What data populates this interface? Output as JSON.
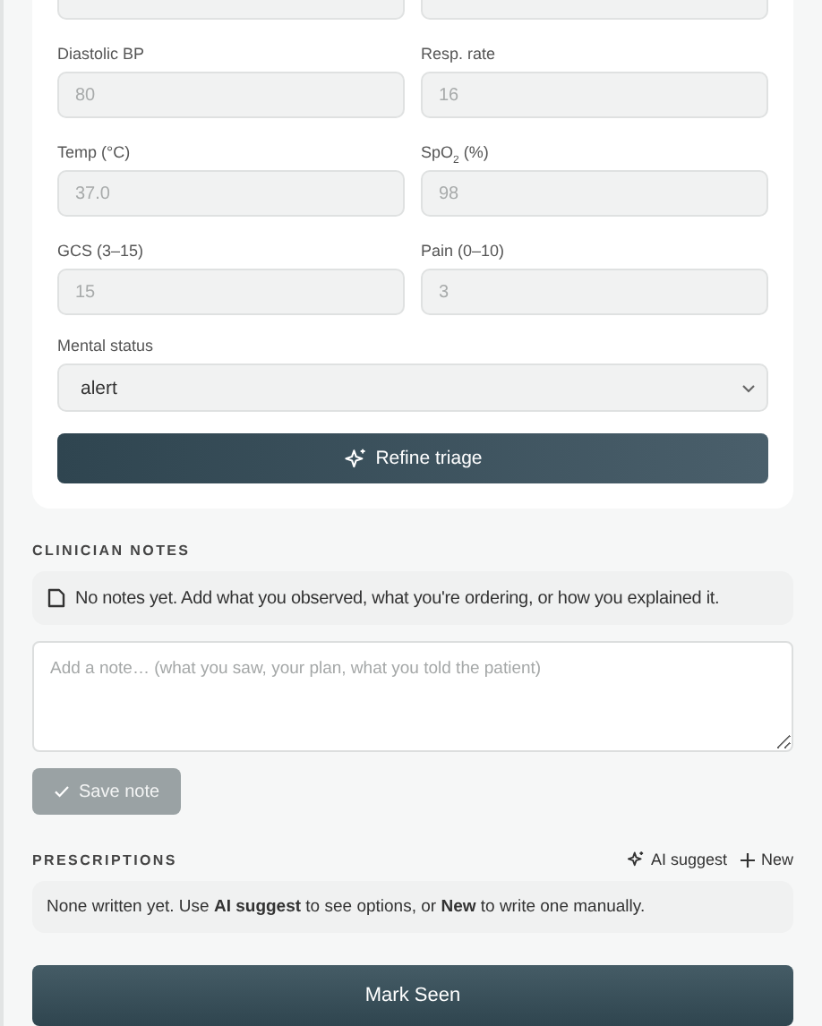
{
  "vitals": [
    {
      "label": "Diastolic BP",
      "placeholder": "80"
    },
    {
      "label": "Resp. rate",
      "placeholder": "16"
    },
    {
      "label": "Temp (°C)",
      "placeholder": "37.0"
    },
    {
      "label": "SpO$_{2}$ (%)",
      "placeholder": "98"
    },
    {
      "label": "GCS (3–15)",
      "placeholder": "15"
    },
    {
      "label": "Pain (0–10)",
      "placeholder": "3"
    }
  ],
  "mental_status": {
    "label": "Mental status",
    "value": "alert"
  },
  "refine_button": "Refine triage",
  "notes": {
    "heading": "CLINICIAN NOTES",
    "empty_text": "No notes yet. Add what you observed, what you're ordering, or how you explained it.",
    "placeholder": "Add a note… (what you saw, your plan, what you told the patient)",
    "save_button": "Save note",
    "save_disabled": true
  },
  "prescriptions": {
    "heading": "PRESCRIPTIONS",
    "ai_button": "AI suggest",
    "new_button": "New",
    "empty_text": "None written yet. Use **AI suggest** to see options, or **New** to write one manually."
  },
  "mark_seen_button": "Mark Seen"
}
